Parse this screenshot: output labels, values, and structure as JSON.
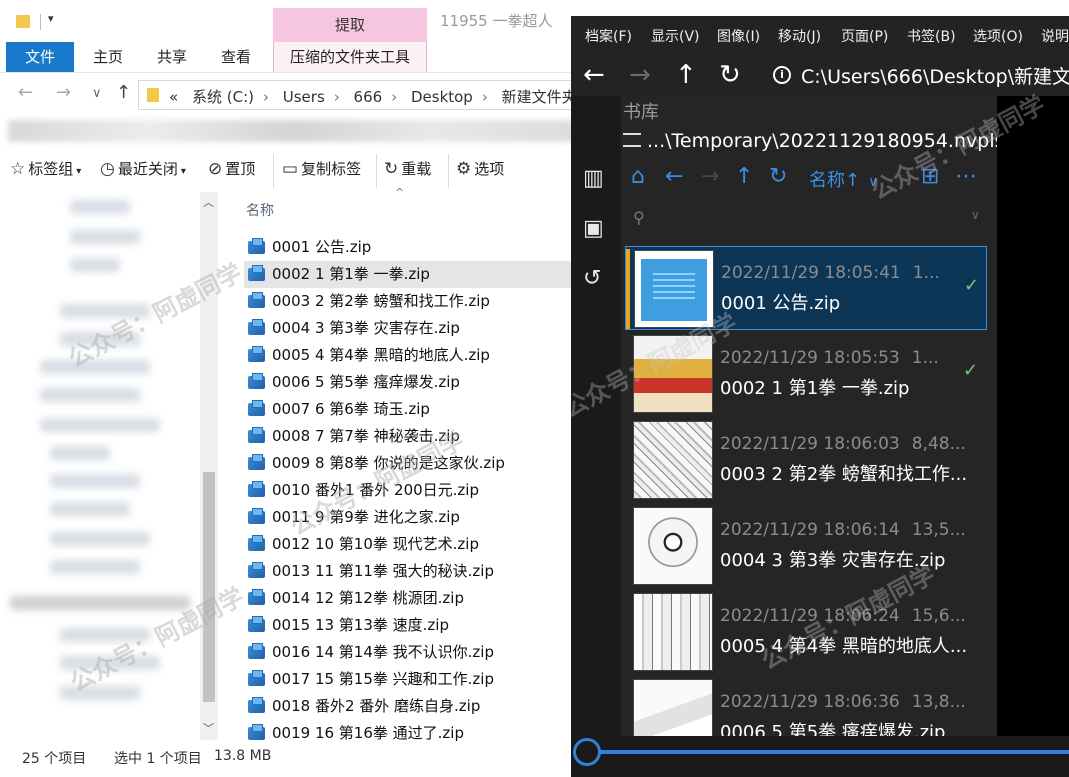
{
  "explorer": {
    "window_title": "11955 一拳超人",
    "contextual_tab_header": "提取",
    "ribbon_tabs": [
      "文件",
      "主页",
      "共享",
      "查看",
      "压缩的文件夹工具"
    ],
    "breadcrumb": [
      "«",
      "系统 (C:)",
      "Users",
      "666",
      "Desktop",
      "新建文件夹"
    ],
    "toolbar": {
      "tags": "标签组",
      "recent_closed": "最近关闭",
      "pin": "置顶",
      "copy_tabs": "复制标签",
      "reload": "重载",
      "options": "选项"
    },
    "column_name": "名称",
    "files": [
      "0001 公告.zip",
      "0002 1 第1拳 一拳.zip",
      "0003 2 第2拳 螃蟹和找工作.zip",
      "0004 3 第3拳 灾害存在.zip",
      "0005 4 第4拳 黑暗的地底人.zip",
      "0006 5 第5拳 瘙痒爆发.zip",
      "0007 6 第6拳 琦玉.zip",
      "0008 7 第7拳 神秘袭击.zip",
      "0009 8 第8拳 你说的是这家伙.zip",
      "0010 番外1 番外 200日元.zip",
      "0011 9 第9拳 进化之家.zip",
      "0012 10 第10拳 现代艺术.zip",
      "0013 11 第11拳 强大的秘诀.zip",
      "0014 12 第12拳 桃源团.zip",
      "0015 13 第13拳 速度.zip",
      "0016 14 第14拳 我不认识你.zip",
      "0017 15 第15拳 兴趣和工作.zip",
      "0018 番外2 番外 磨练自身.zip",
      "0019 16 第16拳 通过了.zip"
    ],
    "selected_index": 1,
    "status": {
      "count": "25 个项目",
      "selected": "选中 1 个项目",
      "size": "13.8 MB"
    }
  },
  "viewer": {
    "menu": [
      "档案(F)",
      "显示(V)",
      "图像(I)",
      "移动(J)",
      "页面(P)",
      "书签(B)",
      "选项(O)",
      "说明"
    ],
    "address": "C:\\Users\\666\\Desktop\\新建文",
    "panel_title": "书库",
    "panel_path": "...\\Temporary\\20221129180954.nvpls",
    "sort_label": "名称↑",
    "books": [
      {
        "date": "2022/11/29 18:05:41",
        "size": "1...",
        "name": "0001 公告.zip",
        "checked": true,
        "selected": true
      },
      {
        "date": "2022/11/29 18:05:53",
        "size": "1...",
        "name": "0002 1 第1拳 一拳.zip",
        "checked": true,
        "selected": false
      },
      {
        "date": "2022/11/29 18:06:03",
        "size": "8,48...",
        "name": "0003 2 第2拳 螃蟹和找工作...",
        "checked": false,
        "selected": false
      },
      {
        "date": "2022/11/29 18:06:14",
        "size": "13,5...",
        "name": "0004 3 第3拳 灾害存在.zip",
        "checked": false,
        "selected": false
      },
      {
        "date": "2022/11/29 18:06:24",
        "size": "15,6...",
        "name": "0005 4 第4拳 黑暗的地底人...",
        "checked": false,
        "selected": false
      },
      {
        "date": "2022/11/29 18:06:36",
        "size": "13,8...",
        "name": "0006 5 第5拳 瘙痒爆发.zip",
        "checked": false,
        "selected": false
      }
    ]
  },
  "watermark": "公众号：阿虚同学"
}
